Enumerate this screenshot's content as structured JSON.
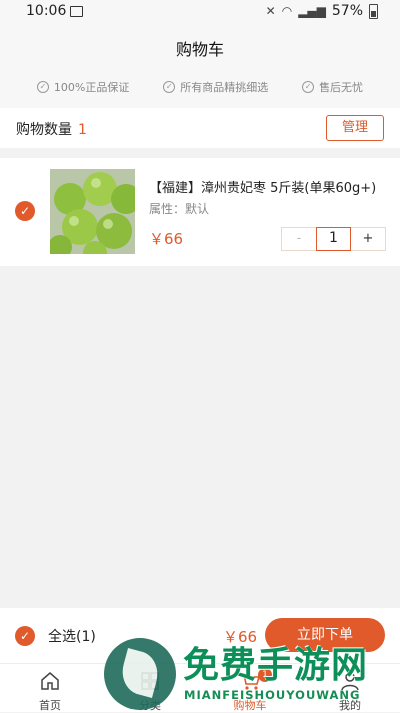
{
  "status_bar": {
    "time": "10:06",
    "battery": "57%"
  },
  "header": {
    "title": "购物车",
    "guarantees": [
      "100%正品保证",
      "所有商品精挑细选",
      "售后无忧"
    ]
  },
  "cart_count": {
    "label": "购物数量",
    "value": "1",
    "manage_label": "管理"
  },
  "cart_items": [
    {
      "name": "【福建】漳州贵妃枣 5斤装(单果60g+)",
      "attribute": "属性：默认",
      "price": "￥66",
      "quantity": "1",
      "minus": "-",
      "plus": "+"
    }
  ],
  "bottom_bar": {
    "select_all_label": "全选(1)",
    "total": "￥66",
    "order_button": "立即下单"
  },
  "tabs": [
    {
      "label": "首页",
      "icon": "home-icon"
    },
    {
      "label": "分类",
      "icon": "category-icon"
    },
    {
      "label": "购物车",
      "icon": "cart-icon",
      "badge": "1"
    },
    {
      "label": "我的",
      "icon": "user-icon"
    }
  ],
  "watermark": {
    "title": "免费手游网",
    "subtitle": "MIANFEISHOUYOUWANG"
  },
  "colors": {
    "accent": "#e05a2b",
    "background": "#f2f2f2"
  }
}
